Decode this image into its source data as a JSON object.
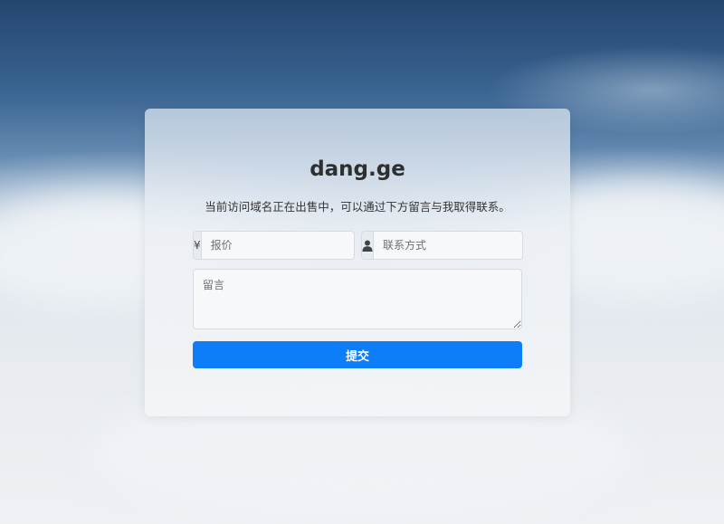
{
  "card": {
    "title": "dang.ge",
    "subtitle": "当前访问域名正在出售中，可以通过下方留言与我取得联系。"
  },
  "form": {
    "price": {
      "addon": "¥",
      "placeholder": "报价",
      "value": ""
    },
    "contact": {
      "addon_icon": "user-icon",
      "placeholder": "联系方式",
      "value": ""
    },
    "message": {
      "placeholder": "留言",
      "value": ""
    },
    "submit_label": "提交"
  },
  "colors": {
    "accent": "#0d7ef8",
    "sky_top": "#24466f"
  }
}
